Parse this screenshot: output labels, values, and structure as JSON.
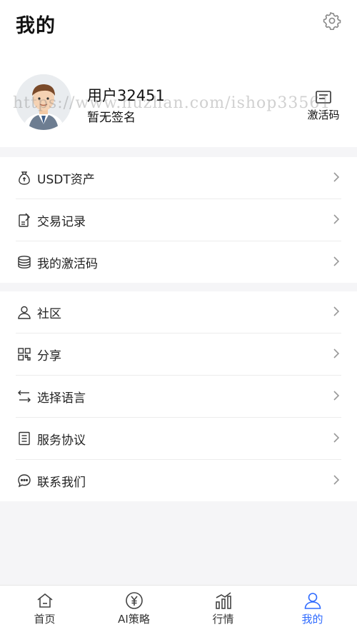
{
  "header": {
    "title": "我的"
  },
  "profile": {
    "username": "用户32451",
    "signature": "暂无签名",
    "activate_label": "激活码"
  },
  "watermark": "https://www.huzhan.com/ishop33561",
  "menu_group_1": [
    {
      "label": "USDT资产",
      "icon": "money-bag-icon"
    },
    {
      "label": "交易记录",
      "icon": "document-edit-icon"
    },
    {
      "label": "我的激活码",
      "icon": "coin-stack-icon"
    }
  ],
  "menu_group_2": [
    {
      "label": "社区",
      "icon": "user-icon"
    },
    {
      "label": "分享",
      "icon": "grid-qr-icon"
    },
    {
      "label": "选择语言",
      "icon": "swap-arrows-icon"
    },
    {
      "label": "服务协议",
      "icon": "document-icon"
    },
    {
      "label": "联系我们",
      "icon": "chat-bubble-icon"
    }
  ],
  "tabbar": {
    "items": [
      {
        "label": "首页",
        "icon": "home-icon"
      },
      {
        "label": "AI策略",
        "icon": "yuan-circle-icon"
      },
      {
        "label": "行情",
        "icon": "bar-chart-icon"
      },
      {
        "label": "我的",
        "icon": "user-icon"
      }
    ],
    "active_index": 3
  },
  "colors": {
    "accent": "#2f6bff",
    "background": "#f5f5f7"
  }
}
